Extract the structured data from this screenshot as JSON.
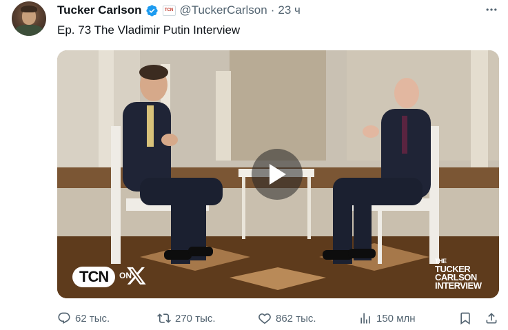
{
  "tweet": {
    "author_name": "Tucker Carlson",
    "handle": "@TuckerCarlson",
    "separator": "·",
    "time": "23 ч",
    "affiliate_badge": "TCN",
    "text": "Ep. 73  The Vladimir Putin Interview",
    "verified_color": "#1d9bf0"
  },
  "media": {
    "logo_tcn": "TCN",
    "logo_on": "ON",
    "brand_line1": "THE",
    "brand_line2": "TUCKER",
    "brand_line3": "CARLSON",
    "brand_line4": "INTERVIEW"
  },
  "actions": {
    "replies": "62 тыс.",
    "reposts": "270 тыс.",
    "likes": "862 тыс.",
    "views": "150 млн"
  },
  "icons": [
    "more-icon",
    "verified-icon",
    "play-icon",
    "reply-icon",
    "repost-icon",
    "like-icon",
    "views-icon",
    "bookmark-icon",
    "share-icon"
  ]
}
